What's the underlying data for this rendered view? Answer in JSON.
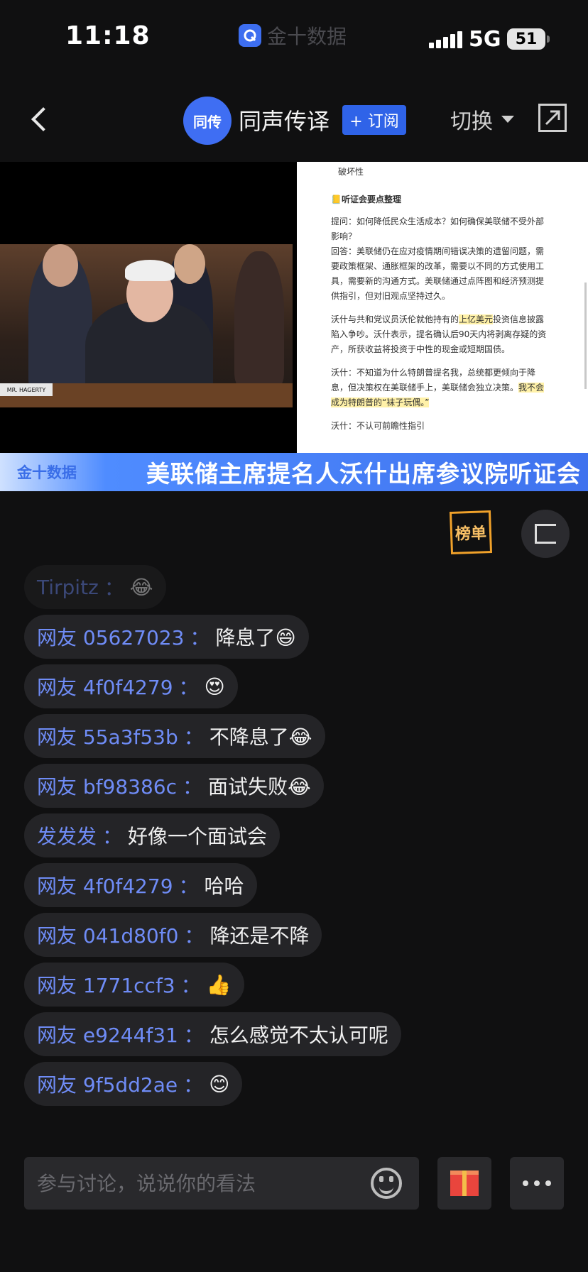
{
  "status_bar": {
    "time": "11:18",
    "app_name": "金十数据",
    "network": "5G",
    "battery": "51"
  },
  "header": {
    "avatar_label": "同传",
    "title": "同声传译",
    "subscribe_label": "+ 订阅",
    "switch_label": "切换"
  },
  "video": {
    "nameplate": "MR. HAGERTY",
    "doc_top_text": "破坏性",
    "doc_heading": "📒听证会要点整理",
    "doc_p1": "提问：如何降低民众生活成本？如何确保美联储不受外部影响？",
    "doc_p2": "回答：美联储仍在应对疫情期间错误决策的遗留问题，需要政策框架、通胀框架的改革，需要以不同的方式使用工具，需要新的沟通方式。美联储通过点阵图和经济预测提供指引，但对旧观点坚持过久。",
    "doc_p3_a": "沃什与共和党议员沃伦就他持有的",
    "doc_p3_hl": "上亿美元",
    "doc_p3_b": "投资信息披露陷入争吵。沃什表示，提名确认后90天内将剥离存疑的资产，所获收益将投资于中性的现金或短期国债。",
    "doc_p4_a": "沃什：不知道为什么特朗普提名我，总统都更倾向于降息，但决策权在美联储手上，美联储会独立决策。",
    "doc_p4_hl": "我不会成为特朗普的“袜子玩偶。”",
    "doc_bottom_text": "沃什：不认可前瞻性指引"
  },
  "banner": {
    "logo": "金十数据",
    "title": "美联储主席提名人沃什出席参议院听证会"
  },
  "ranking_label": "榜单",
  "comments": [
    {
      "user": "Tirpitz",
      "msg": "😂"
    },
    {
      "user": "网友 05627023",
      "msg": "降息了😄"
    },
    {
      "user": "网友 4f0f4279",
      "msg": "😍"
    },
    {
      "user": "网友 55a3f53b",
      "msg": "不降息了😂"
    },
    {
      "user": "网友 bf98386c",
      "msg": "面试失败😂"
    },
    {
      "user": "发发发",
      "msg": "好像一个面试会"
    },
    {
      "user": "网友 4f0f4279",
      "msg": "哈哈"
    },
    {
      "user": "网友 041d80f0",
      "msg": "降还是不降"
    },
    {
      "user": "网友 1771ccf3",
      "msg": "👍"
    },
    {
      "user": "网友 e9244f31",
      "msg": "怎么感觉不太认可呢"
    },
    {
      "user": "网友 9f5dd2ae",
      "msg": "😊"
    }
  ],
  "input": {
    "placeholder": "参与讨论，说说你的看法"
  }
}
